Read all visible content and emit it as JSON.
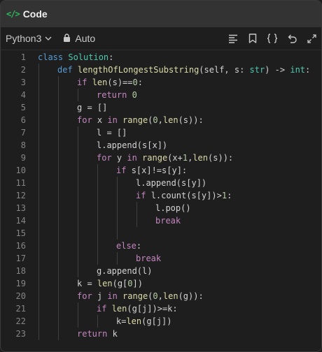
{
  "header": {
    "icon": "code-tag-icon",
    "icon_text": "</>",
    "title": "Code"
  },
  "toolbar": {
    "language": "Python3",
    "auto_label": "Auto"
  },
  "editor": {
    "lines": [
      {
        "n": "1",
        "indent": 0,
        "tokens": [
          [
            "kw",
            "class "
          ],
          [
            "cls",
            "Solution"
          ],
          [
            "p",
            ":"
          ]
        ]
      },
      {
        "n": "2",
        "indent": 1,
        "tokens": [
          [
            "kw",
            "def "
          ],
          [
            "fn",
            "lengthOfLongestSubstring"
          ],
          [
            "p",
            "(self, s: "
          ],
          [
            "bi",
            "str"
          ],
          [
            "p",
            ") -> "
          ],
          [
            "bi",
            "int"
          ],
          [
            "p",
            ":"
          ]
        ]
      },
      {
        "n": "3",
        "indent": 2,
        "tokens": [
          [
            "kw2",
            "if "
          ],
          [
            "fn",
            "len"
          ],
          [
            "p",
            "(s)=="
          ],
          [
            "num",
            "0"
          ],
          [
            "p",
            ":"
          ]
        ]
      },
      {
        "n": "4",
        "indent": 3,
        "tokens": [
          [
            "kw2",
            "return "
          ],
          [
            "num",
            "0"
          ]
        ]
      },
      {
        "n": "5",
        "indent": 2,
        "tokens": [
          [
            "p",
            "g = []"
          ]
        ]
      },
      {
        "n": "6",
        "indent": 2,
        "tokens": [
          [
            "kw2",
            "for "
          ],
          [
            "p",
            "x "
          ],
          [
            "kw2",
            "in "
          ],
          [
            "fn",
            "range"
          ],
          [
            "p",
            "("
          ],
          [
            "num",
            "0"
          ],
          [
            "p",
            ","
          ],
          [
            "fn",
            "len"
          ],
          [
            "p",
            "(s)):"
          ]
        ]
      },
      {
        "n": "7",
        "indent": 3,
        "tokens": [
          [
            "p",
            "l = []"
          ]
        ]
      },
      {
        "n": "8",
        "indent": 3,
        "tokens": [
          [
            "p",
            "l.append(s[x])"
          ]
        ]
      },
      {
        "n": "9",
        "indent": 3,
        "tokens": [
          [
            "kw2",
            "for "
          ],
          [
            "p",
            "y "
          ],
          [
            "kw2",
            "in "
          ],
          [
            "fn",
            "range"
          ],
          [
            "p",
            "(x+"
          ],
          [
            "num",
            "1"
          ],
          [
            "p",
            ","
          ],
          [
            "fn",
            "len"
          ],
          [
            "p",
            "(s)):"
          ]
        ]
      },
      {
        "n": "10",
        "indent": 4,
        "tokens": [
          [
            "kw2",
            "if "
          ],
          [
            "p",
            "s[x]!=s[y]:"
          ]
        ]
      },
      {
        "n": "11",
        "indent": 5,
        "tokens": [
          [
            "p",
            "l.append(s[y])"
          ]
        ]
      },
      {
        "n": "12",
        "indent": 5,
        "tokens": [
          [
            "kw2",
            "if "
          ],
          [
            "p",
            "l.count(s[y])>"
          ],
          [
            "num",
            "1"
          ],
          [
            "p",
            ":"
          ]
        ]
      },
      {
        "n": "13",
        "indent": 6,
        "tokens": [
          [
            "p",
            "l.pop()"
          ]
        ]
      },
      {
        "n": "14",
        "indent": 6,
        "tokens": [
          [
            "kw2",
            "break"
          ]
        ]
      },
      {
        "n": "15",
        "indent": 5,
        "tokens": []
      },
      {
        "n": "16",
        "indent": 4,
        "tokens": [
          [
            "kw2",
            "else"
          ],
          [
            "p",
            ":"
          ]
        ]
      },
      {
        "n": "17",
        "indent": 5,
        "tokens": [
          [
            "kw2",
            "break"
          ]
        ]
      },
      {
        "n": "18",
        "indent": 3,
        "tokens": [
          [
            "p",
            "g.append(l)"
          ]
        ]
      },
      {
        "n": "19",
        "indent": 2,
        "tokens": [
          [
            "p",
            "k = "
          ],
          [
            "fn",
            "len"
          ],
          [
            "p",
            "(g["
          ],
          [
            "num",
            "0"
          ],
          [
            "p",
            "])"
          ]
        ]
      },
      {
        "n": "20",
        "indent": 2,
        "tokens": [
          [
            "kw2",
            "for "
          ],
          [
            "p",
            "j "
          ],
          [
            "kw2",
            "in "
          ],
          [
            "fn",
            "range"
          ],
          [
            "p",
            "("
          ],
          [
            "num",
            "0"
          ],
          [
            "p",
            ","
          ],
          [
            "fn",
            "len"
          ],
          [
            "p",
            "(g)):"
          ]
        ]
      },
      {
        "n": "21",
        "indent": 3,
        "tokens": [
          [
            "kw2",
            "if "
          ],
          [
            "fn",
            "len"
          ],
          [
            "p",
            "(g[j])>=k:"
          ]
        ]
      },
      {
        "n": "22",
        "indent": 4,
        "tokens": [
          [
            "p",
            "k="
          ],
          [
            "fn",
            "len"
          ],
          [
            "p",
            "(g[j])"
          ]
        ]
      },
      {
        "n": "23",
        "indent": 2,
        "tokens": [
          [
            "kw2",
            "return "
          ],
          [
            "p",
            "k"
          ]
        ]
      }
    ]
  },
  "icons": {
    "format": "align-left-icon",
    "bookmark": "bookmark-icon",
    "braces": "braces-icon",
    "reset": "undo-icon",
    "expand": "expand-icon",
    "lock": "lock-icon",
    "chevron": "chevron-down-icon"
  },
  "colors": {
    "accent": "#2cbb5d",
    "keyword": "#569cd6",
    "control": "#c586c0",
    "function": "#dcdcaa",
    "class": "#4ec9b0",
    "number": "#b5cea8"
  }
}
